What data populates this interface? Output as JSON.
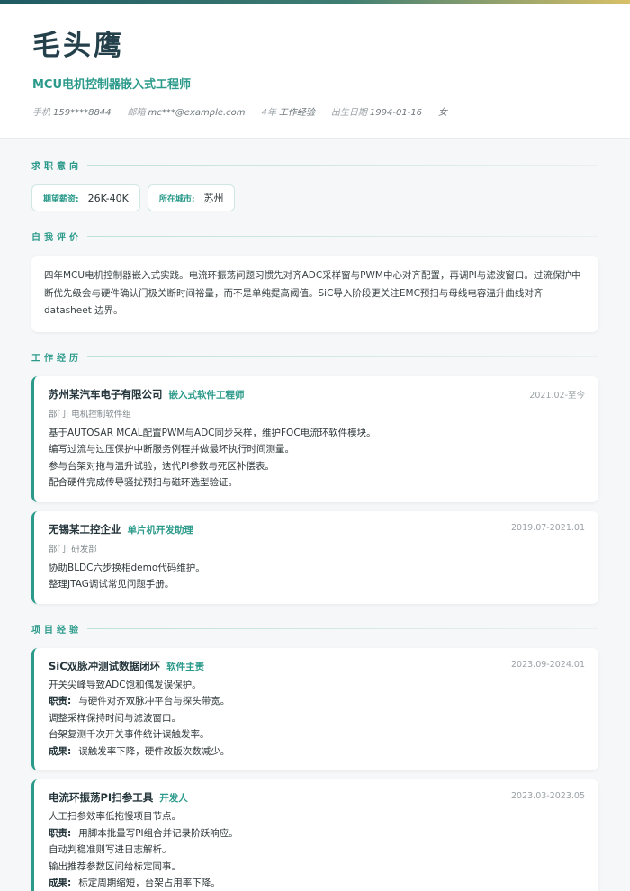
{
  "header": {
    "name": "毛头鹰",
    "title": "MCU电机控制器嵌入式工程师",
    "meta": [
      {
        "key": "手机",
        "value": "159****8844"
      },
      {
        "key": "邮箱",
        "value": "mc***@example.com"
      },
      {
        "key": "4年",
        "value": "工作经验"
      },
      {
        "key": "出生日期",
        "value": "1994-01-16"
      },
      {
        "key": "",
        "value": "女"
      }
    ]
  },
  "intent": {
    "section_title": "求职意向",
    "salary_label": "期望薪资:",
    "salary_value": "26K-40K",
    "city_label": "所在城市:",
    "city_value": "苏州"
  },
  "summary": {
    "section_title": "自我评价",
    "text": "四年MCU电机控制器嵌入式实践。电流环振荡问题习惯先对齐ADC采样窗与PWM中心对齐配置，再调PI与滤波窗口。过流保护中断优先级会与硬件确认门极关断时间裕量，而不是单纯提高阈值。SiC导入阶段更关注EMC预扫与母线电容温升曲线对齐 datasheet 边界。"
  },
  "work": {
    "section_title": "工作经历",
    "items": [
      {
        "company": "苏州某汽车电子有限公司",
        "role": "嵌入式软件工程师",
        "date": "2021.02-至今",
        "dept": "部门: 电机控制软件组",
        "bullets": [
          "基于AUTOSAR MCAL配置PWM与ADC同步采样，维护FOC电流环软件模块。",
          "编写过流与过压保护中断服务例程并做最坏执行时间测量。",
          "参与台架对拖与温升试验，迭代PI参数与死区补偿表。",
          "配合硬件完成传导骚扰预扫与磁环选型验证。"
        ]
      },
      {
        "company": "无锡某工控企业",
        "role": "单片机开发助理",
        "date": "2019.07-2021.01",
        "dept": "部门: 研发部",
        "bullets": [
          "协助BLDC六步换相demo代码维护。",
          "整理JTAG调试常见问题手册。"
        ]
      }
    ]
  },
  "projects": {
    "section_title": "项目经验",
    "items": [
      {
        "name": "SiC双脉冲测试数据闭环",
        "role": "软件主责",
        "date": "2023.09-2024.01",
        "desc": "开关尖峰导致ADC饱和偶发误保护。",
        "duty_label": "职责:",
        "duties": [
          "与硬件对齐双脉冲平台与探头带宽。",
          "调整采样保持时间与滤波窗口。",
          "台架复测千次开关事件统计误触发率。"
        ],
        "result_label": "成果:",
        "result": "误触发率下降，硬件改版次数减少。"
      },
      {
        "name": "电流环振荡PI扫参工具",
        "role": "开发人",
        "date": "2023.03-2023.05",
        "desc": "人工扫参效率低拖慢项目节点。",
        "duty_label": "职责:",
        "duties": [
          "用脚本批量写PI组合并记录阶跃响应。",
          "自动判稳准则写进日志解析。",
          "输出推荐参数区间给标定同事。"
        ],
        "result_label": "成果:",
        "result": "标定周期缩短，台架占用率下降。"
      }
    ]
  },
  "colors": {
    "accent": "#2b9a8a",
    "name": "#24404a"
  }
}
